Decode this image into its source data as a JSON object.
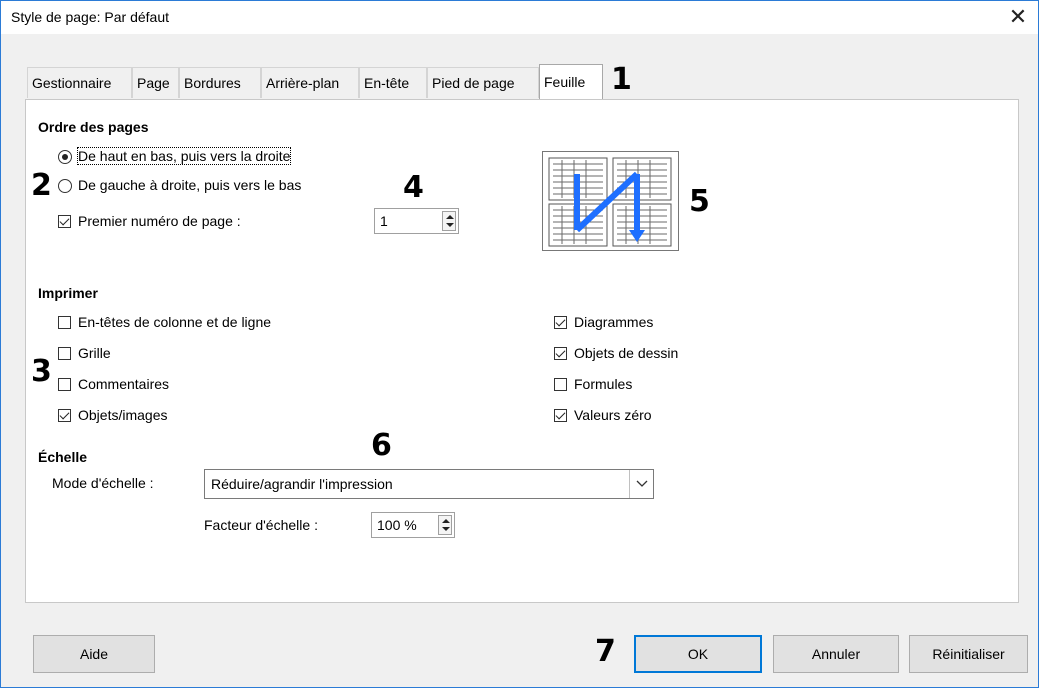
{
  "window": {
    "title": "Style de page: Par défaut",
    "close_glyph": "✕"
  },
  "tabs": [
    {
      "label": "Gestionnaire"
    },
    {
      "label": "Page"
    },
    {
      "label": "Bordures"
    },
    {
      "label": "Arrière-plan"
    },
    {
      "label": "En-tête"
    },
    {
      "label": "Pied de page"
    },
    {
      "label": "Feuille",
      "active": true
    }
  ],
  "page_order": {
    "heading": "Ordre des pages",
    "top_then_right": "De haut en bas, puis vers la droite",
    "left_then_down": "De gauche à droite, puis vers le bas",
    "selected": "top_then_right",
    "first_page_number": {
      "label": "Premier numéro de page :",
      "checked": true,
      "value": "1"
    }
  },
  "print": {
    "heading": "Imprimer",
    "col_row_headers": {
      "label": "En-têtes de colonne et de ligne",
      "checked": false
    },
    "grid": {
      "label": "Grille",
      "checked": false
    },
    "comments": {
      "label": "Commentaires",
      "checked": false
    },
    "objects_images": {
      "label": "Objets/images",
      "checked": true
    },
    "charts": {
      "label": "Diagrammes",
      "checked": true
    },
    "drawing_objects": {
      "label": "Objets de dessin",
      "checked": true
    },
    "formulas": {
      "label": "Formules",
      "checked": false
    },
    "zero_values": {
      "label": "Valeurs zéro",
      "checked": true
    }
  },
  "scale": {
    "heading": "Échelle",
    "mode_label": "Mode d'échelle :",
    "mode_value": "Réduire/agrandir l'impression",
    "factor_label": "Facteur d'échelle :",
    "factor_value": "100 %"
  },
  "callouts": {
    "n1": "1",
    "n2": "2",
    "n3": "3",
    "n4": "4",
    "n5": "5",
    "n6": "6",
    "n7": "7"
  },
  "buttons": {
    "help": "Aide",
    "ok": "OK",
    "cancel": "Annuler",
    "reset": "Réinitialiser"
  },
  "colors": {
    "accent": "#0078d7",
    "preview_arrow": "#1e6fff"
  }
}
